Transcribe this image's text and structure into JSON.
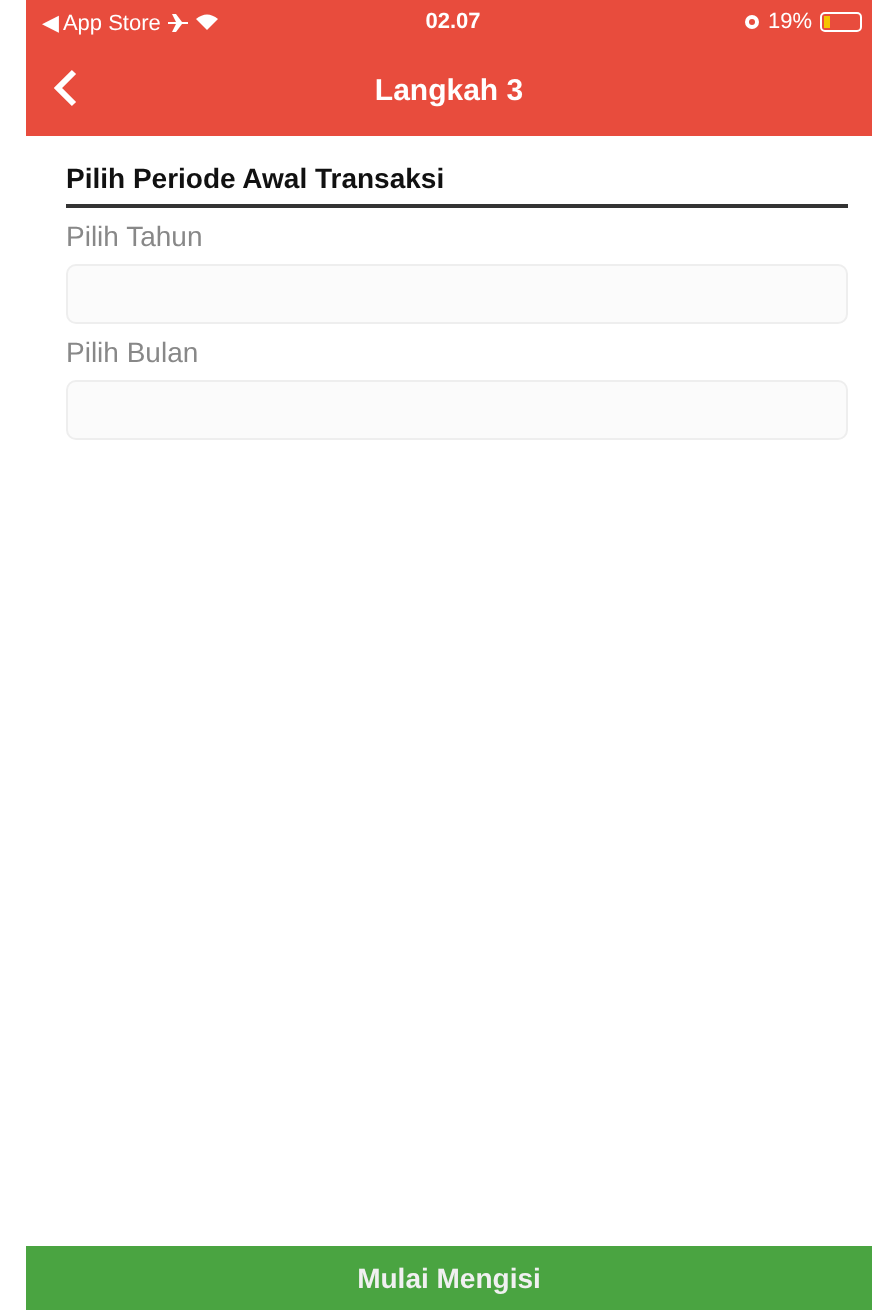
{
  "status_bar": {
    "back_app": "◀ App Store",
    "time": "02.07",
    "battery": "19%"
  },
  "header": {
    "title": "Langkah 3"
  },
  "section": {
    "title": "Pilih Periode Awal Transaksi"
  },
  "fields": [
    {
      "label": "Pilih Tahun"
    },
    {
      "label": "Pilih Bulan"
    }
  ],
  "button": {
    "label": "Mulai Mengisi"
  }
}
